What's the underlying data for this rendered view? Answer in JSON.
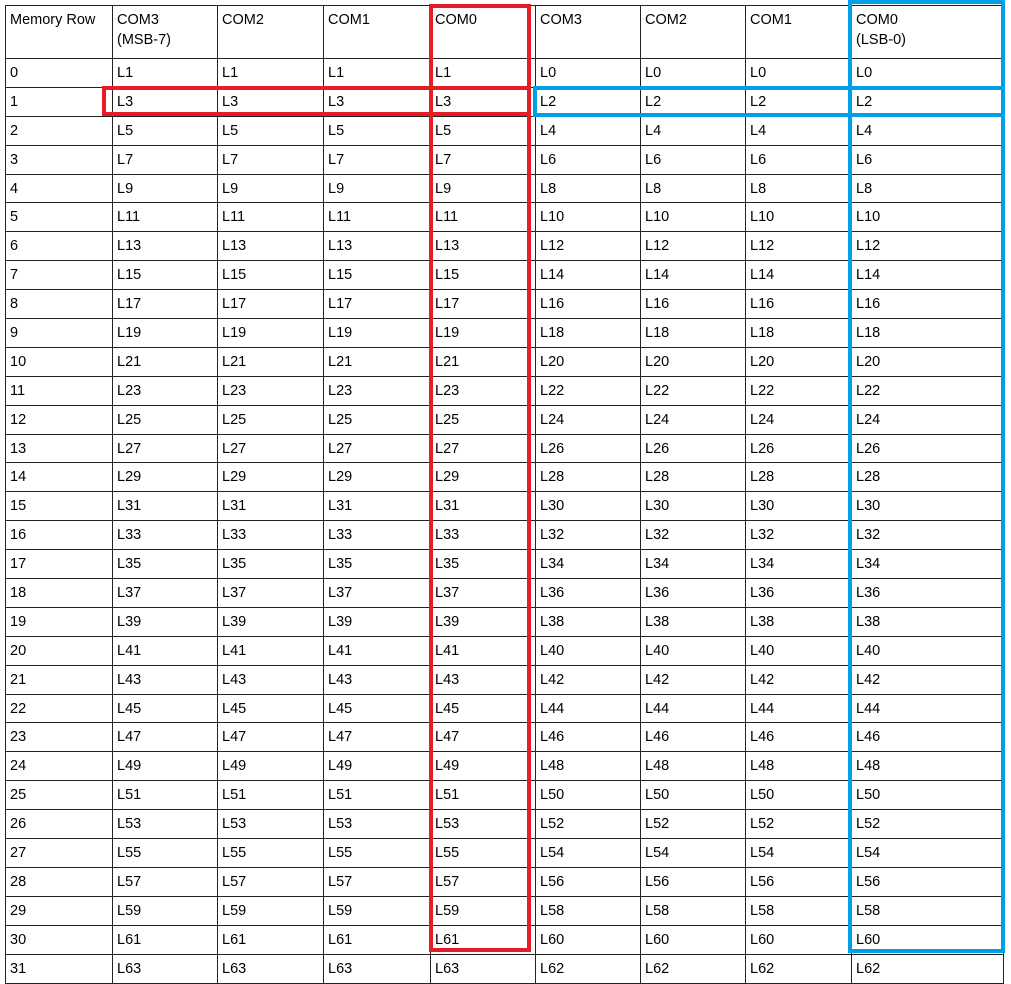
{
  "table": {
    "headers": [
      [
        "Memory Row",
        ""
      ],
      [
        "COM3",
        "(MSB-7)"
      ],
      [
        "COM2",
        ""
      ],
      [
        "COM1",
        ""
      ],
      [
        "COM0",
        ""
      ],
      [
        "COM3",
        ""
      ],
      [
        "COM2",
        ""
      ],
      [
        "COM1",
        ""
      ],
      [
        "COM0",
        "(LSB-0)"
      ]
    ],
    "rows": [
      [
        "0",
        "L1",
        "L1",
        "L1",
        "L1",
        "L0",
        "L0",
        "L0",
        "L0"
      ],
      [
        "1",
        "L3",
        "L3",
        "L3",
        "L3",
        "L2",
        "L2",
        "L2",
        "L2"
      ],
      [
        "2",
        "L5",
        "L5",
        "L5",
        "L5",
        "L4",
        "L4",
        "L4",
        "L4"
      ],
      [
        "3",
        "L7",
        "L7",
        "L7",
        "L7",
        "L6",
        "L6",
        "L6",
        "L6"
      ],
      [
        "4",
        "L9",
        "L9",
        "L9",
        "L9",
        "L8",
        "L8",
        "L8",
        "L8"
      ],
      [
        "5",
        "L11",
        "L11",
        "L11",
        "L11",
        "L10",
        "L10",
        "L10",
        "L10"
      ],
      [
        "6",
        "L13",
        "L13",
        "L13",
        "L13",
        "L12",
        "L12",
        "L12",
        "L12"
      ],
      [
        "7",
        "L15",
        "L15",
        "L15",
        "L15",
        "L14",
        "L14",
        "L14",
        "L14"
      ],
      [
        "8",
        "L17",
        "L17",
        "L17",
        "L17",
        "L16",
        "L16",
        "L16",
        "L16"
      ],
      [
        "9",
        "L19",
        "L19",
        "L19",
        "L19",
        "L18",
        "L18",
        "L18",
        "L18"
      ],
      [
        "10",
        "L21",
        "L21",
        "L21",
        "L21",
        "L20",
        "L20",
        "L20",
        "L20"
      ],
      [
        "11",
        "L23",
        "L23",
        "L23",
        "L23",
        "L22",
        "L22",
        "L22",
        "L22"
      ],
      [
        "12",
        "L25",
        "L25",
        "L25",
        "L25",
        "L24",
        "L24",
        "L24",
        "L24"
      ],
      [
        "13",
        "L27",
        "L27",
        "L27",
        "L27",
        "L26",
        "L26",
        "L26",
        "L26"
      ],
      [
        "14",
        "L29",
        "L29",
        "L29",
        "L29",
        "L28",
        "L28",
        "L28",
        "L28"
      ],
      [
        "15",
        "L31",
        "L31",
        "L31",
        "L31",
        "L30",
        "L30",
        "L30",
        "L30"
      ],
      [
        "16",
        "L33",
        "L33",
        "L33",
        "L33",
        "L32",
        "L32",
        "L32",
        "L32"
      ],
      [
        "17",
        "L35",
        "L35",
        "L35",
        "L35",
        "L34",
        "L34",
        "L34",
        "L34"
      ],
      [
        "18",
        "L37",
        "L37",
        "L37",
        "L37",
        "L36",
        "L36",
        "L36",
        "L36"
      ],
      [
        "19",
        "L39",
        "L39",
        "L39",
        "L39",
        "L38",
        "L38",
        "L38",
        "L38"
      ],
      [
        "20",
        "L41",
        "L41",
        "L41",
        "L41",
        "L40",
        "L40",
        "L40",
        "L40"
      ],
      [
        "21",
        "L43",
        "L43",
        "L43",
        "L43",
        "L42",
        "L42",
        "L42",
        "L42"
      ],
      [
        "22",
        "L45",
        "L45",
        "L45",
        "L45",
        "L44",
        "L44",
        "L44",
        "L44"
      ],
      [
        "23",
        "L47",
        "L47",
        "L47",
        "L47",
        "L46",
        "L46",
        "L46",
        "L46"
      ],
      [
        "24",
        "L49",
        "L49",
        "L49",
        "L49",
        "L48",
        "L48",
        "L48",
        "L48"
      ],
      [
        "25",
        "L51",
        "L51",
        "L51",
        "L51",
        "L50",
        "L50",
        "L50",
        "L50"
      ],
      [
        "26",
        "L53",
        "L53",
        "L53",
        "L53",
        "L52",
        "L52",
        "L52",
        "L52"
      ],
      [
        "27",
        "L55",
        "L55",
        "L55",
        "L55",
        "L54",
        "L54",
        "L54",
        "L54"
      ],
      [
        "28",
        "L57",
        "L57",
        "L57",
        "L57",
        "L56",
        "L56",
        "L56",
        "L56"
      ],
      [
        "29",
        "L59",
        "L59",
        "L59",
        "L59",
        "L58",
        "L58",
        "L58",
        "L58"
      ],
      [
        "30",
        "L61",
        "L61",
        "L61",
        "L61",
        "L60",
        "L60",
        "L60",
        "L60"
      ],
      [
        "31",
        "L63",
        "L63",
        "L63",
        "L63",
        "L62",
        "L62",
        "L62",
        "L62"
      ]
    ]
  },
  "highlights": {
    "odd_color": "#e41e26",
    "even_color": "#00a0e4"
  }
}
